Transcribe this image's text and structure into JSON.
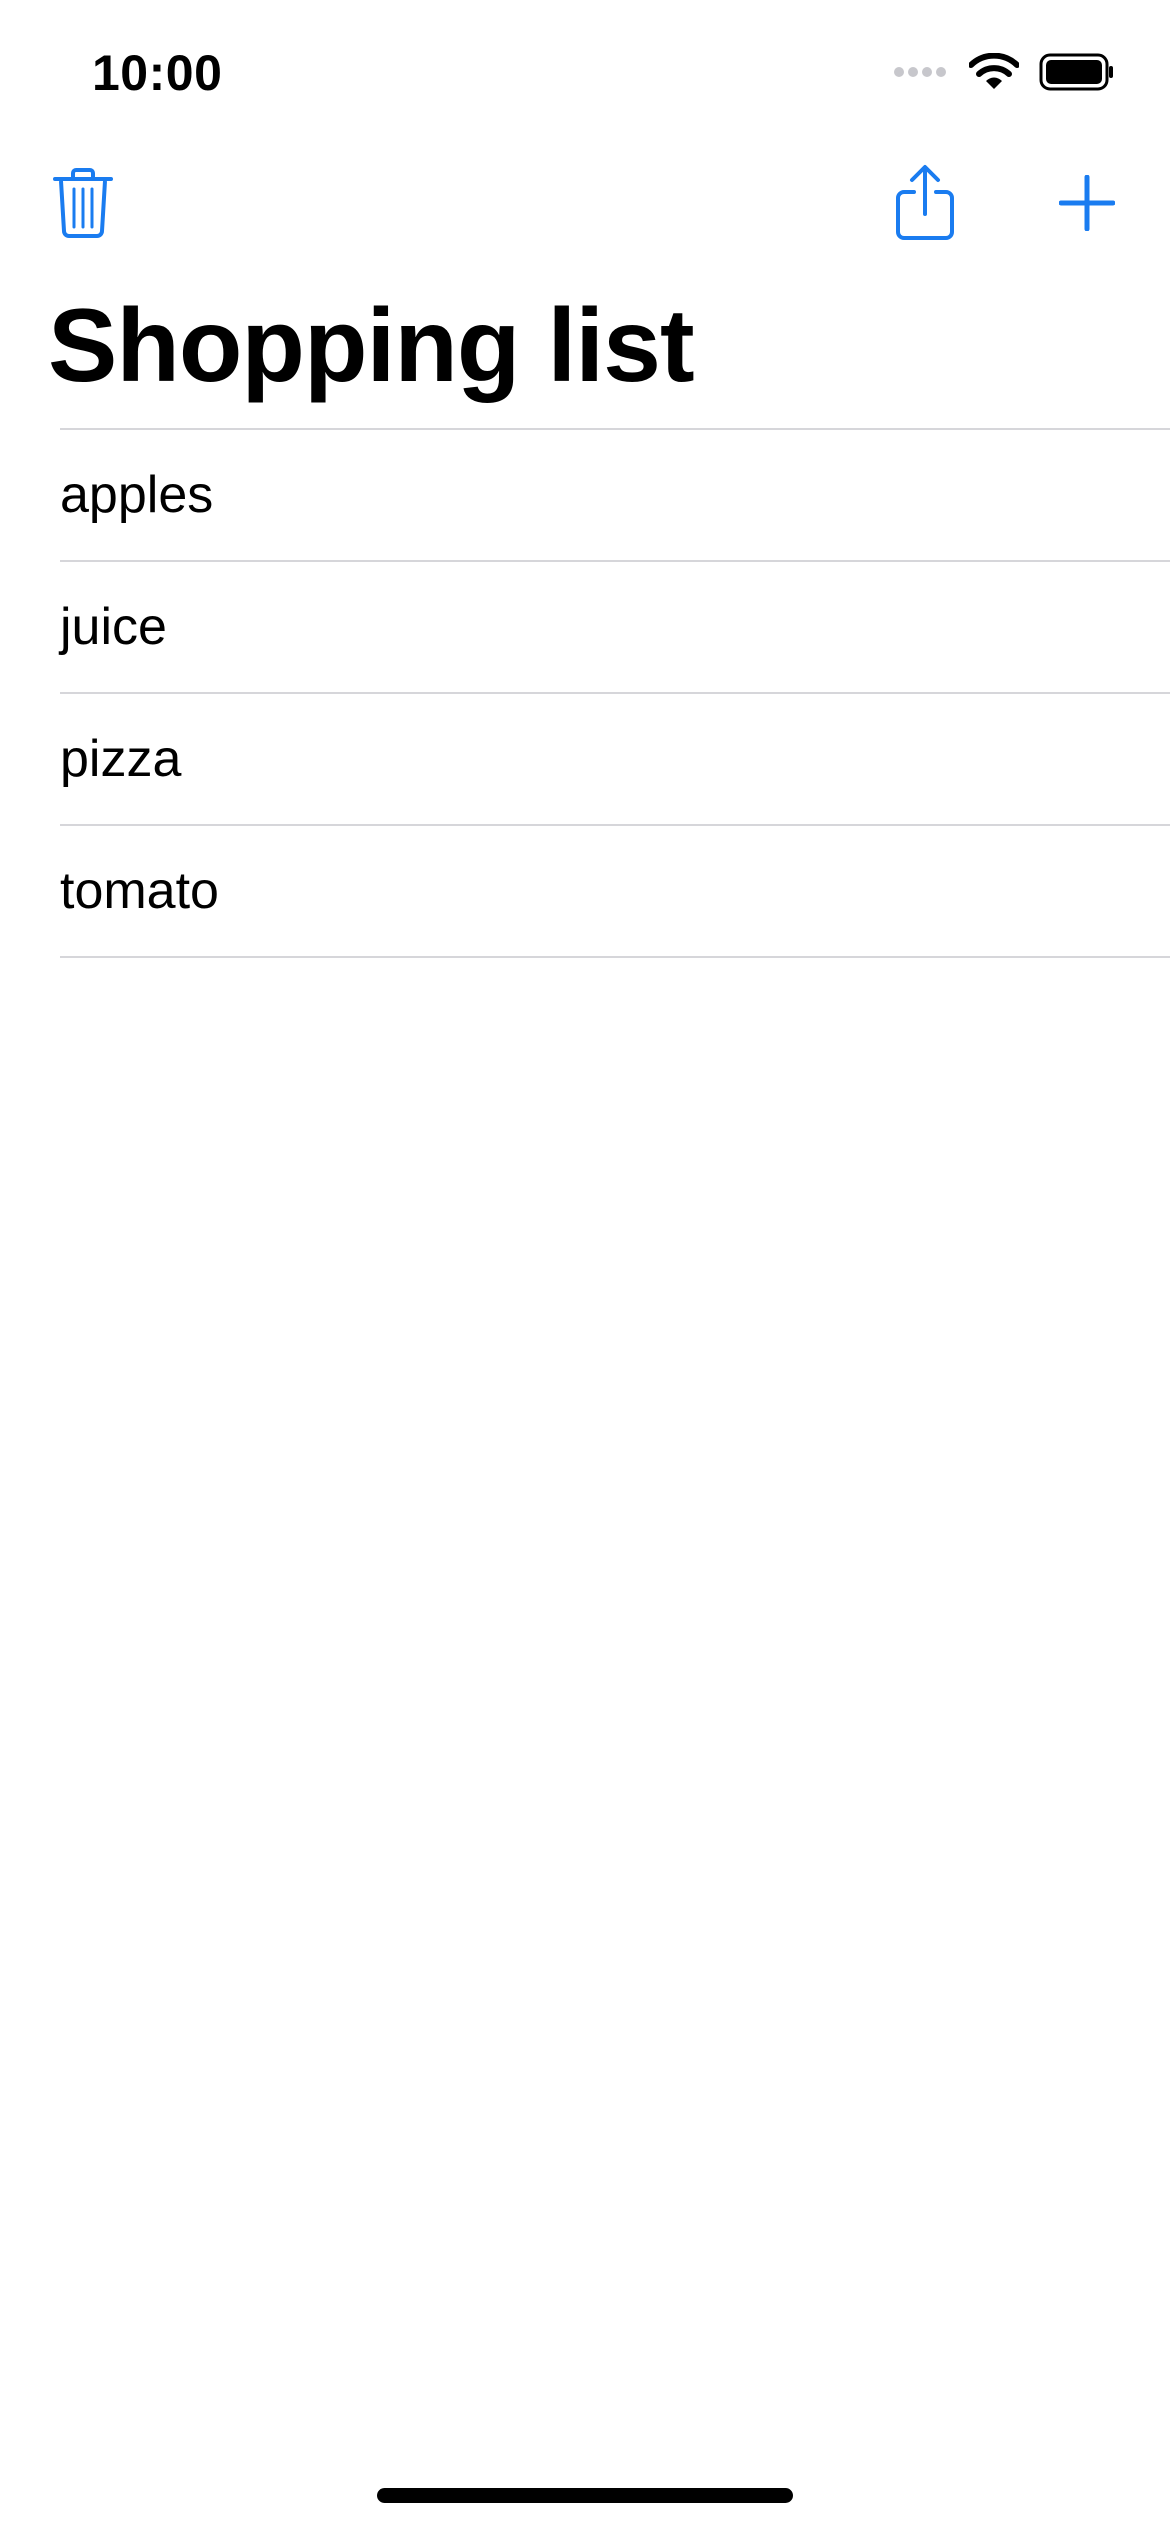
{
  "status_bar": {
    "time": "10:00",
    "icons": [
      "signal-dots-icon",
      "wifi-icon",
      "battery-icon"
    ]
  },
  "toolbar": {
    "left": {
      "icon": "trash-icon"
    },
    "right": [
      {
        "icon": "share-icon"
      },
      {
        "icon": "plus-icon"
      }
    ]
  },
  "title": "Shopping list",
  "items": [
    {
      "label": "apples"
    },
    {
      "label": "juice"
    },
    {
      "label": "pizza"
    },
    {
      "label": "tomato"
    }
  ],
  "colors": {
    "accent": "#1a7cf0",
    "separator": "#d6d6da",
    "text": "#000000",
    "background": "#ffffff"
  }
}
